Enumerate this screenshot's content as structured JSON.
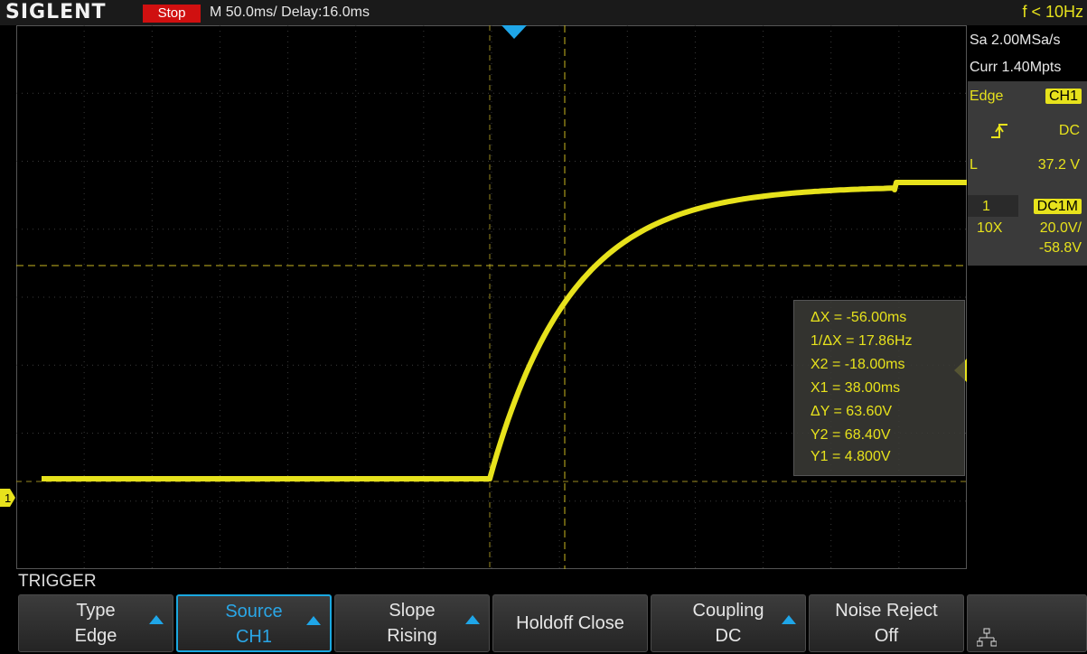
{
  "header": {
    "brand": "SIGLENT",
    "status": "Stop",
    "timebase": "M 50.0ms/ Delay:16.0ms",
    "frequency": "f < 10Hz"
  },
  "acquisition": {
    "sample_rate": "Sa 2.00MSa/s",
    "memory": "Curr 1.40Mpts"
  },
  "trigger_info": {
    "type": "Edge",
    "source": "CH1",
    "slope_icon": "rising-edge-icon",
    "coupling": "DC",
    "level_label": "L",
    "level": "37.2 V"
  },
  "channel_info": {
    "number": "1",
    "coupling": "DC1M",
    "probe": "10X",
    "scale": "20.0V/",
    "offset": "-58.8V"
  },
  "cursor_measurements": [
    "ΔX = -56.00ms",
    "1/ΔX = 17.86Hz",
    "X2 = -18.00ms",
    "X1 = 38.00ms",
    "ΔY = 63.60V",
    "Y2 = 68.40V",
    "Y1 = 4.800V"
  ],
  "channel_marker": "1",
  "menu": {
    "title": "TRIGGER",
    "softkeys": [
      {
        "line1": "Type",
        "line2": "Edge",
        "arrow": true,
        "active": false
      },
      {
        "line1": "Source",
        "line2": "CH1",
        "arrow": true,
        "active": true
      },
      {
        "line1": "Slope",
        "line2": "Rising",
        "arrow": true,
        "active": false
      },
      {
        "line1": "Holdoff Close",
        "line2": "",
        "arrow": false,
        "active": false
      },
      {
        "line1": "Coupling",
        "line2": "DC",
        "arrow": true,
        "active": false
      },
      {
        "line1": "Noise Reject",
        "line2": "Off",
        "arrow": false,
        "active": false
      }
    ],
    "network_icon": "network-icon"
  },
  "colors": {
    "trace": "#e7e21c",
    "accent": "#1fa6e8",
    "stop": "#d01010"
  }
}
